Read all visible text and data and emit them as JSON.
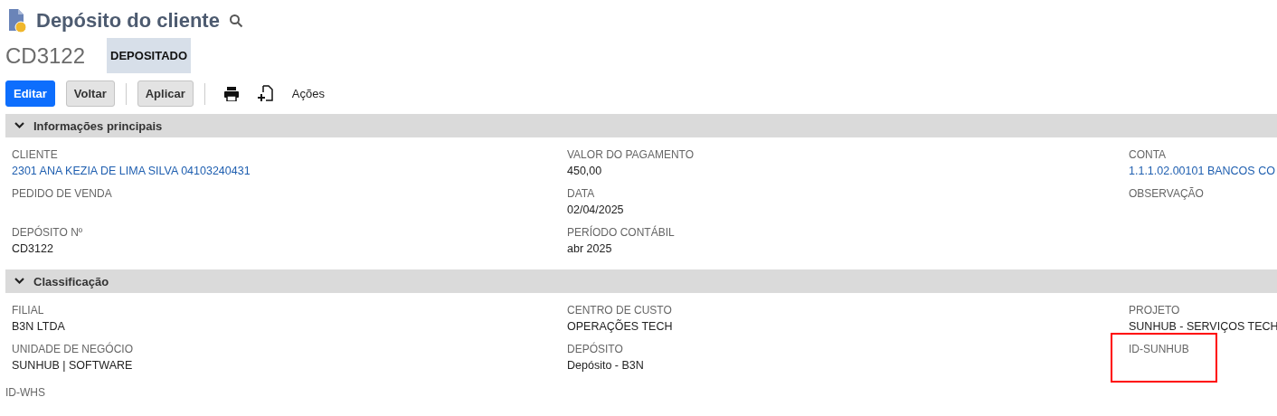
{
  "page": {
    "title": "Depósito do cliente",
    "record_id": "CD3122",
    "status": "DEPOSITADO"
  },
  "toolbar": {
    "buttons": [
      {
        "label": "Editar",
        "kind": "primary"
      },
      {
        "label": "Voltar",
        "kind": "secondary"
      },
      {
        "label": "Aplicar",
        "kind": "secondary"
      }
    ],
    "actions_label": "Ações"
  },
  "sections": [
    {
      "title": "Informações principais",
      "expanded": true,
      "rows": [
        [
          {
            "label": "CLIENTE",
            "value": "2301 ANA KEZIA DE LIMA SILVA 04103240431",
            "link": true
          },
          {
            "label": "VALOR DO PAGAMENTO",
            "value": "450,00",
            "link": false
          },
          {
            "label": "CONTA",
            "value": "1.1.1.02.00101 BANCOS CO",
            "link": true
          }
        ],
        [
          {
            "label": "PEDIDO DE VENDA"
          },
          {
            "label": "DATA",
            "value": "02/04/2025",
            "link": false
          },
          {
            "label": "OBSERVAÇÃO"
          }
        ],
        [
          {
            "label": "DEPÓSITO Nº",
            "value": "CD3122",
            "link": false
          },
          {
            "label": "PERÍODO CONTÁBIL",
            "value": "abr 2025",
            "link": false
          }
        ]
      ]
    },
    {
      "title": "Classificação",
      "expanded": true,
      "rows": [
        [
          {
            "label": "FILIAL",
            "value": "B3N LTDA",
            "link": false
          },
          {
            "label": "CENTRO DE CUSTO",
            "value": "OPERAÇÕES TECH",
            "link": false
          },
          {
            "label": "PROJETO",
            "value": "SUNHUB - SERVIÇOS TECH",
            "link": false
          }
        ],
        [
          {
            "label": "UNIDADE DE NEGÓCIO",
            "value": "SUNHUB | SOFTWARE",
            "link": false
          },
          {
            "label": "DEPÓSITO",
            "value": "Depósito - B3N",
            "link": false
          },
          {
            "label": "ID-SUNHUB",
            "highlighted": true
          }
        ]
      ]
    }
  ],
  "footer_label": "ID-WHS"
}
